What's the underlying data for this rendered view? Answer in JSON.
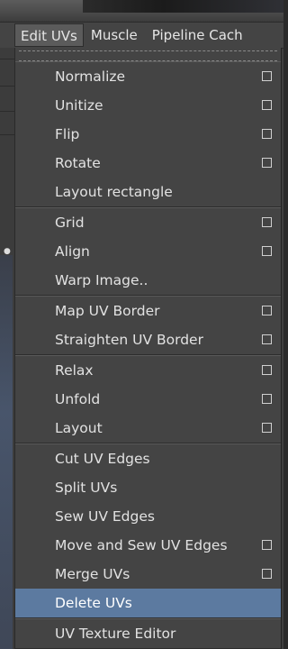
{
  "menubar": {
    "items": [
      "Edit UVs",
      "Muscle",
      "Pipeline Cach"
    ]
  },
  "menu": {
    "groups": [
      [
        {
          "label": "Normalize",
          "has_option_box": true
        },
        {
          "label": "Unitize",
          "has_option_box": true
        },
        {
          "label": "Flip",
          "has_option_box": true
        },
        {
          "label": "Rotate",
          "has_option_box": true
        },
        {
          "label": "Layout rectangle",
          "has_option_box": false
        }
      ],
      [
        {
          "label": "Grid",
          "has_option_box": true
        },
        {
          "label": "Align",
          "has_option_box": true
        },
        {
          "label": "Warp Image..",
          "has_option_box": false
        }
      ],
      [
        {
          "label": "Map UV Border",
          "has_option_box": true
        },
        {
          "label": "Straighten UV Border",
          "has_option_box": true
        }
      ],
      [
        {
          "label": "Relax",
          "has_option_box": true
        },
        {
          "label": "Unfold",
          "has_option_box": true
        },
        {
          "label": "Layout",
          "has_option_box": true
        }
      ],
      [
        {
          "label": "Cut UV Edges",
          "has_option_box": false
        },
        {
          "label": "Split UVs",
          "has_option_box": false
        },
        {
          "label": "Sew UV Edges",
          "has_option_box": false
        },
        {
          "label": "Move and Sew UV Edges",
          "has_option_box": true
        },
        {
          "label": "Merge UVs",
          "has_option_box": true
        },
        {
          "label": "Delete UVs",
          "has_option_box": false,
          "highlighted": true
        }
      ],
      [
        {
          "label": "UV Texture Editor",
          "has_option_box": false
        }
      ]
    ]
  },
  "colors": {
    "menu_bg": "#444444",
    "highlight": "#5c7aa0",
    "text": "#e2e2e2"
  }
}
